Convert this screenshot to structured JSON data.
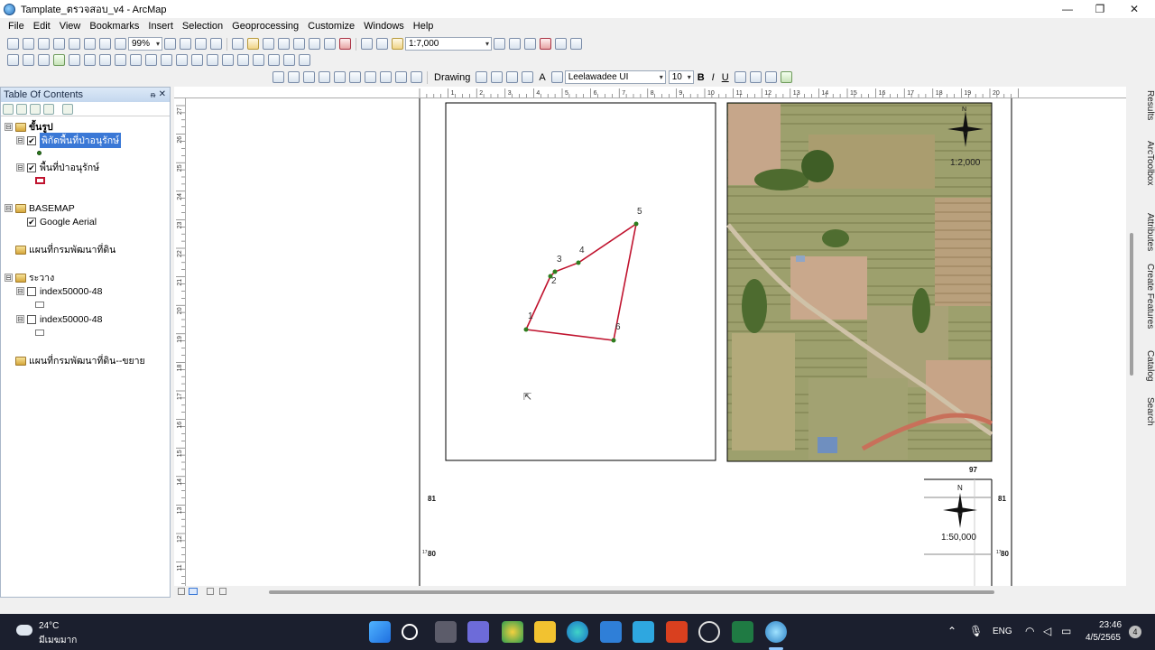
{
  "window": {
    "title": "Tamplate_ตรวจสอบ_v4 - ArcMap",
    "minimize_glyph": "—",
    "maximize_glyph": "❐",
    "close_glyph": "✕"
  },
  "menubar": {
    "items": [
      "File",
      "Edit",
      "View",
      "Bookmarks",
      "Insert",
      "Selection",
      "Geoprocessing",
      "Customize",
      "Windows",
      "Help"
    ]
  },
  "toolbar": {
    "zoom_percent": "99%",
    "scale_value": "1:7,000",
    "drawing_label": "Drawing",
    "font_name": "Leelawadee UI",
    "font_size": "10",
    "bold": "B",
    "italic": "I",
    "underline": "U",
    "text_tool": "A"
  },
  "toc": {
    "title": "Table Of Contents",
    "pin": "ᵰ",
    "close": "✕",
    "groups": [
      {
        "name": "ขั้นรูป",
        "expander": "⊟"
      },
      {
        "name": "BASEMAP",
        "expander": "⊟"
      },
      {
        "name": "แผนที่กรมพัฒนาที่ดิน",
        "expander": ""
      },
      {
        "name": "ระวาง",
        "expander": "⊟"
      },
      {
        "name": "แผนที่กรมพัฒนาที่ดิน--ขยาย",
        "expander": ""
      }
    ],
    "layers": [
      {
        "name": "พิกัดพื้นที่ป่าอนุรักษ์",
        "checked": "✔",
        "selected": true
      },
      {
        "name": "พื้นที่ป่าอนุรักษ์",
        "checked": "✔"
      },
      {
        "name": "Google Aerial",
        "checked": "✔"
      },
      {
        "name": "index50000-48",
        "checked": ""
      },
      {
        "name": "index50000-48",
        "checked": ""
      }
    ]
  },
  "ruler": {
    "top_ticks": [
      "1",
      "2",
      "3",
      "4",
      "5",
      "6",
      "7",
      "8",
      "9",
      "10",
      "11",
      "12",
      "13",
      "14",
      "15",
      "16",
      "17",
      "18",
      "19",
      "20"
    ],
    "left_ticks": [
      "27",
      "26",
      "25",
      "24",
      "23",
      "22",
      "21",
      "20",
      "19",
      "18",
      "17",
      "16",
      "15",
      "14",
      "13",
      "12",
      "11"
    ]
  },
  "map": {
    "points": [
      "1",
      "2",
      "3",
      "4",
      "5",
      "6"
    ],
    "aerial_scale": "1:2,000",
    "north_label": "N",
    "index_scale": "1:50,000",
    "grid_labels": {
      "top": "97",
      "left_81": "81",
      "right_81": "81",
      "left_80": "80",
      "right_80": "80",
      "sup17": "17"
    }
  },
  "side_tabs": [
    "Results",
    "ArcToolbox",
    "Attributes",
    "Create Features",
    "Catalog",
    "Search"
  ],
  "taskbar": {
    "weather_temp": "24°C",
    "weather_desc": "มีเมฆมาก",
    "language": "ENG",
    "time": "23:46",
    "date": "4/5/2565",
    "notification_count": "4"
  },
  "colors": {
    "polygon_line": "#c0142f",
    "vertex": "#2e7d1e",
    "selection_blue": "#3a78d6"
  }
}
